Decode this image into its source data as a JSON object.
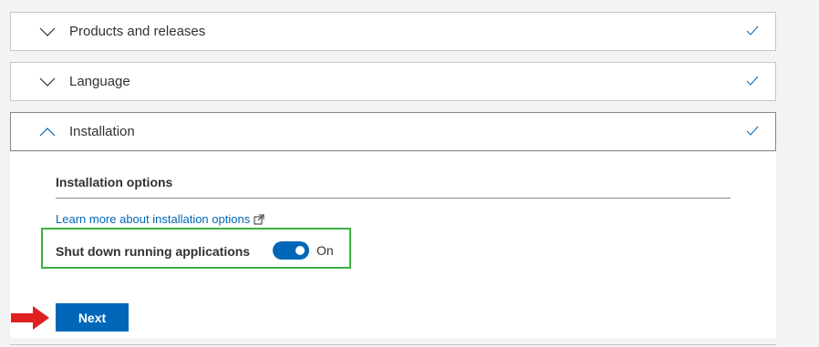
{
  "sections": {
    "products": {
      "title": "Products and releases",
      "completed": true
    },
    "language": {
      "title": "Language",
      "completed": true
    },
    "installation": {
      "title": "Installation",
      "completed": true
    }
  },
  "installation_options": {
    "heading": "Installation options",
    "learn_more_link": "Learn more about installation options",
    "shutdown_label": "Shut down running applications",
    "shutdown_state": "On"
  },
  "next_button": "Next",
  "colors": {
    "accent": "#0067b8",
    "highlight_box": "#3cb043",
    "arrow": "#e02020"
  },
  "icons": [
    "chevron-down-icon",
    "chevron-up-icon",
    "checkmark-icon",
    "external-link-icon",
    "red-arrow-icon"
  ]
}
